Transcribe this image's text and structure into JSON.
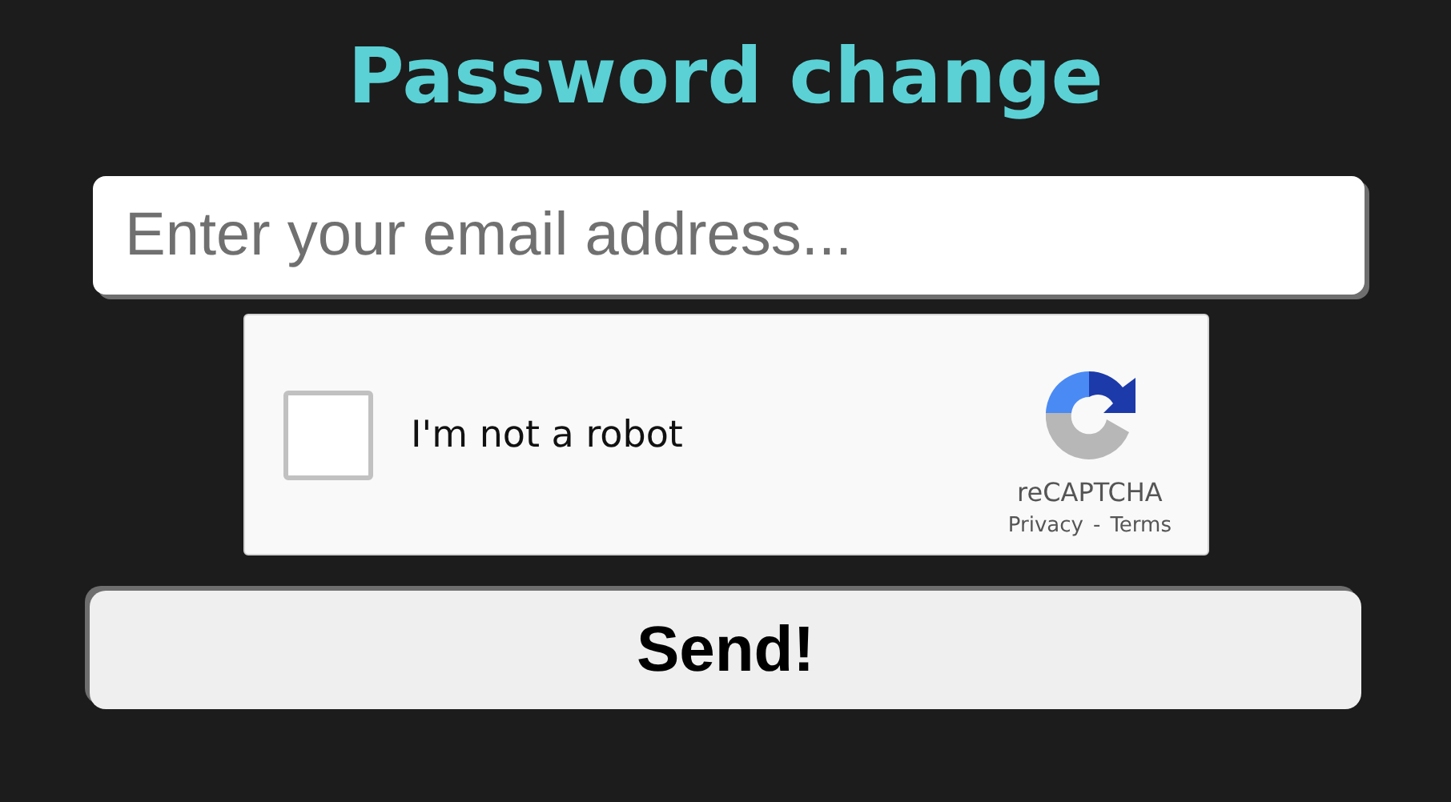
{
  "title": "Password change",
  "email_field": {
    "placeholder": "Enter your email address..."
  },
  "captcha": {
    "label": "I'm not a robot",
    "checked": false,
    "brand": "reCAPTCHA",
    "links": [
      "Privacy",
      "Terms"
    ],
    "separator": "-"
  },
  "submit_button": {
    "label": "Send!"
  }
}
